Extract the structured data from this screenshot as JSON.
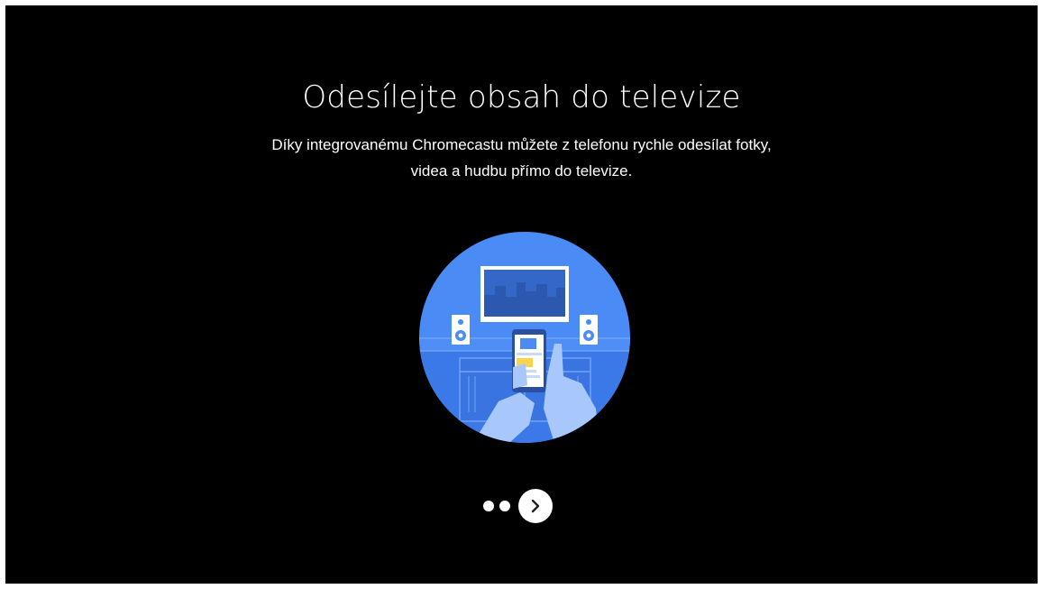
{
  "onboarding": {
    "title": "Odesílejte obsah do televize",
    "description_lines": [
      "Díky integrovanému Chromecastu můžete z telefonu rychle odesílat fotky,",
      "videa a hudbu přímo do televize."
    ]
  },
  "pager": {
    "total_pages": 3,
    "current_page": 3,
    "next_icon": "chevron-right-icon"
  },
  "colors": {
    "background": "#000000",
    "illustration_blue": "#4285f4",
    "text": "#ffffff"
  }
}
